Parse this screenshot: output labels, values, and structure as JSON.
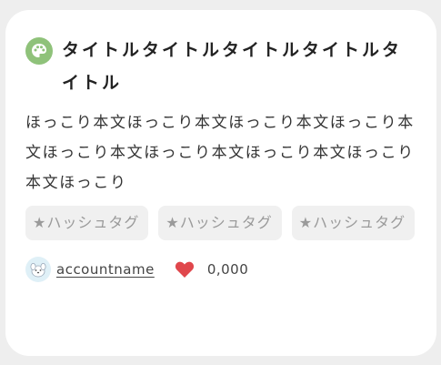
{
  "card": {
    "title": "タイトルタイトルタイトルタイトルタイトル",
    "body": "ほっこり本文ほっこり本文ほっこり本文ほっこり本文ほっこり本文ほっこり本文ほっこり本文ほっこり本文ほっこり",
    "tags": [
      "★ハッシュタグ",
      "★ハッシュタグ",
      "★ハッシュタグ"
    ],
    "account_name": "accountname",
    "like_count": "0,000"
  },
  "colors": {
    "title_icon": "#8fc27a",
    "heart": "#e0474c",
    "tag_bg": "#f0f0f0"
  },
  "icons": {
    "title_icon": "palette-icon",
    "avatar": "avatar-icon",
    "like": "heart-icon"
  }
}
